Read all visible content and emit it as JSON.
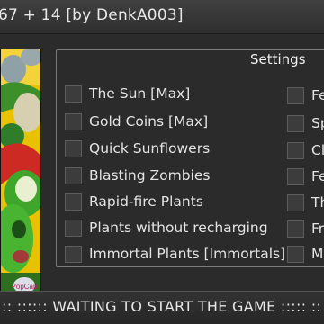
{
  "window": {
    "title": "67 + 14 [by DenkA003]"
  },
  "game_art": {
    "icon": "game-cover-image",
    "brand": "PopCap"
  },
  "settings": {
    "title": "Settings",
    "options_left": [
      {
        "label": "The Sun [Max]",
        "checked": false
      },
      {
        "label": "Gold Coins [Max]",
        "checked": false
      },
      {
        "label": "Quick Sunflowers",
        "checked": false
      },
      {
        "label": "Blasting Zombies",
        "checked": false
      },
      {
        "label": "Rapid-fire Plants",
        "checked": false
      },
      {
        "label": "Plants without recharging",
        "checked": false
      },
      {
        "label": "Immortal Plants [Immortals]",
        "checked": false
      }
    ],
    "options_right": [
      {
        "label": "Fe",
        "checked": false
      },
      {
        "label": "Sp",
        "checked": false
      },
      {
        "label": "Cl",
        "checked": false
      },
      {
        "label": "Fe",
        "checked": false
      },
      {
        "label": "Th",
        "checked": false
      },
      {
        "label": "Fr",
        "checked": false
      },
      {
        "label": "M",
        "checked": false
      }
    ]
  },
  "status": {
    "text": ":: :::::: WAITING TO START THE GAME ::::: ::"
  },
  "colors": {
    "background": "#2b2b2b",
    "panel_border": "#7a7a7a",
    "checkbox": "#3c3c3c"
  }
}
